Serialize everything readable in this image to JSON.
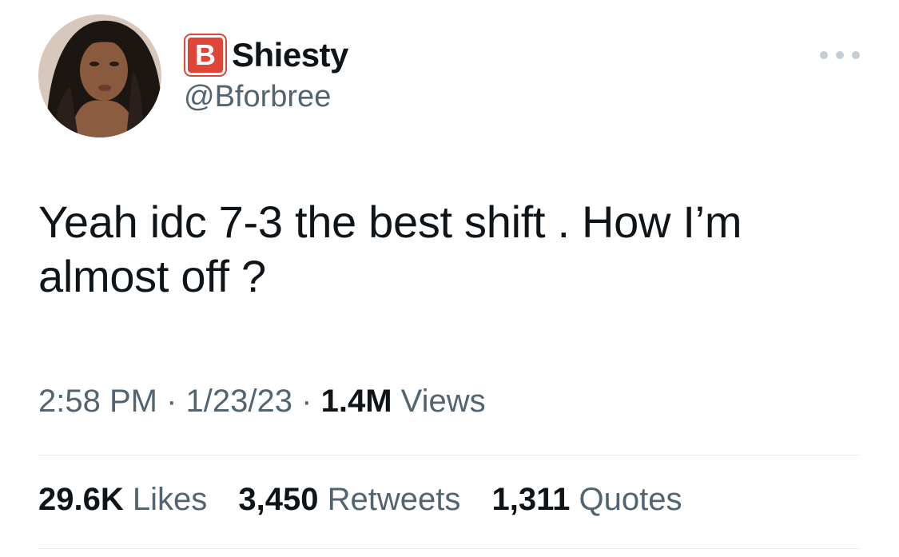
{
  "user": {
    "badge_letter": "B",
    "display_name": "Shiesty",
    "handle": "@Bforbree"
  },
  "tweet": {
    "text": "Yeah idc 7-3 the best shift . How I’m almost off ?"
  },
  "meta": {
    "time": "2:58 PM",
    "separator": "·",
    "date": "1/23/23",
    "views_count": "1.4M",
    "views_label": "Views"
  },
  "stats": {
    "likes_count": "29.6K",
    "likes_label": "Likes",
    "retweets_count": "3,450",
    "retweets_label": "Retweets",
    "quotes_count": "1,311",
    "quotes_label": "Quotes"
  },
  "colors": {
    "badge": "#e0453a",
    "secondary_text": "#536471",
    "primary_text": "#0f1419",
    "divider": "#e6ecf0"
  },
  "icons": {
    "more": "more-horizontal-icon"
  }
}
